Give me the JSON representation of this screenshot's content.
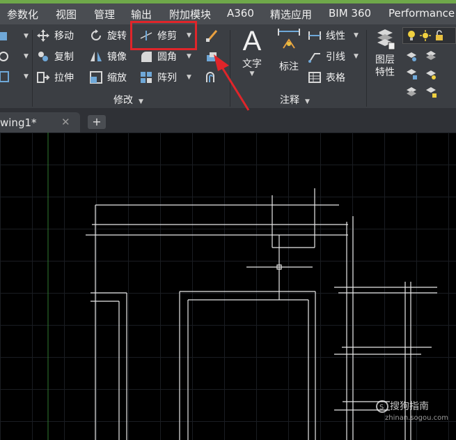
{
  "menubar": {
    "items": [
      "参数化",
      "视图",
      "管理",
      "输出",
      "附加模块",
      "A360",
      "精选应用",
      "BIM 360",
      "Performance"
    ]
  },
  "ribbon": {
    "modify": {
      "move": "移动",
      "rotate": "旋转",
      "trim": "修剪",
      "copy": "复制",
      "mirror": "镜像",
      "fillet": "圆角",
      "stretch": "拉伸",
      "scale": "缩放",
      "array": "阵列",
      "panel_label": "修改"
    },
    "annotation": {
      "text": "文字",
      "dimension": "标注",
      "linear": "线性",
      "leader": "引线",
      "table": "表格",
      "panel_label": "注释"
    },
    "layers": {
      "properties_line1": "图层",
      "properties_line2": "特性"
    }
  },
  "tabs": {
    "document": "wing1*",
    "close": "✕",
    "new": "+"
  },
  "watermark": {
    "brand": "搜狗指南",
    "url": "zhinan.sogou.com"
  },
  "colors": {
    "highlight": "#e0252a",
    "arrow": "#e0252a",
    "accent_bar": "#6fa84a"
  }
}
